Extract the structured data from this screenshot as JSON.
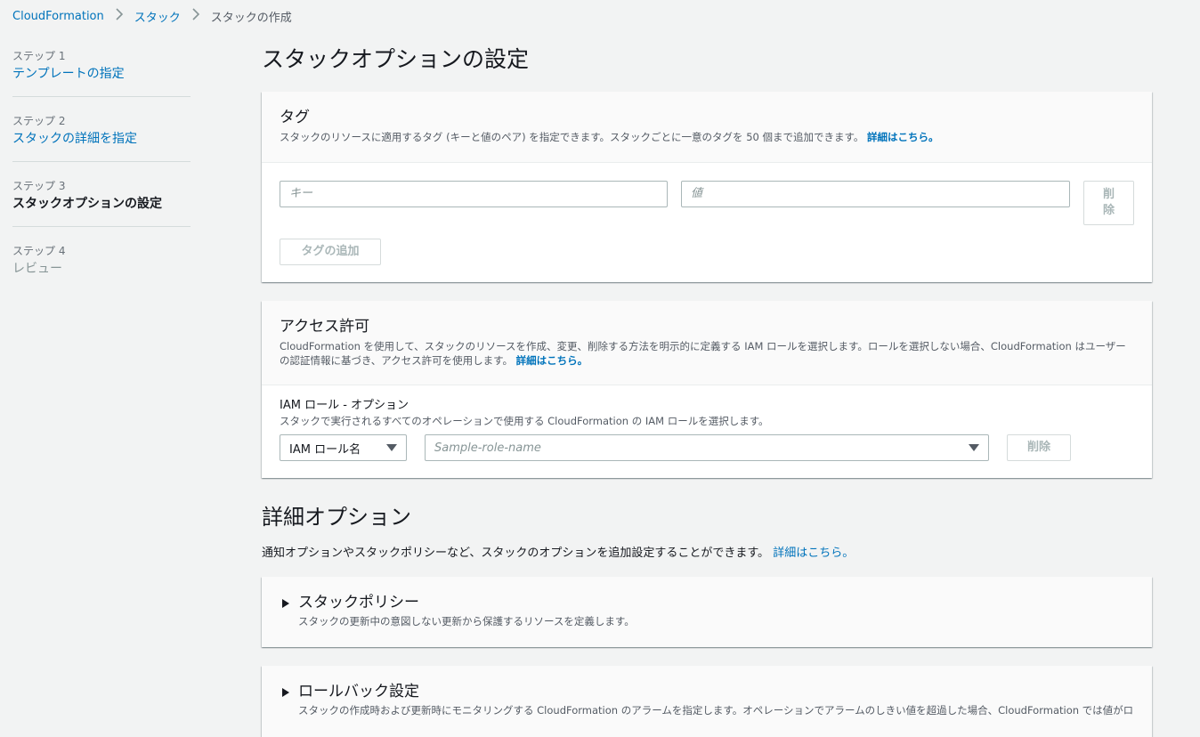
{
  "breadcrumb": {
    "items": [
      "CloudFormation",
      "スタック"
    ],
    "current": "スタックの作成"
  },
  "steps": [
    {
      "num": "ステップ 1",
      "title": "テンプレートの指定",
      "state": "link"
    },
    {
      "num": "ステップ 2",
      "title": "スタックの詳細を指定",
      "state": "link"
    },
    {
      "num": "ステップ 3",
      "title": "スタックオプションの設定",
      "state": "active"
    },
    {
      "num": "ステップ 4",
      "title": "レビュー",
      "state": "disabled"
    }
  ],
  "page_title": "スタックオプションの設定",
  "tags": {
    "title": "タグ",
    "desc": "スタックのリソースに適用するタグ (キーと値のペア) を指定できます。スタックごとに一意のタグを 50 個まで追加できます。",
    "learn_more": "詳細はこちら。",
    "key_placeholder": "キー",
    "value_placeholder": "値",
    "remove_label": "削除",
    "add_label": "タグの追加"
  },
  "permissions": {
    "title": "アクセス許可",
    "desc": "CloudFormation を使用して、スタックのリソースを作成、変更、削除する方法を明示的に定義する IAM ロールを選択します。ロールを選択しない場合、CloudFormation はユーザーの認証情報に基づき、アクセス許可を使用します。",
    "learn_more": "詳細はこちら。",
    "role_label": "IAM ロール - オプション",
    "role_desc": "スタックで実行されるすべてのオペレーションで使用する CloudFormation の IAM ロールを選択します。",
    "role_type": "IAM ロール名",
    "role_placeholder": "Sample-role-name",
    "remove_label": "削除"
  },
  "advanced": {
    "title": "詳細オプション",
    "desc": "通知オプションやスタックポリシーなど、スタックのオプションを追加設定することができます。",
    "learn_more": "詳細はこちら。"
  },
  "stack_policy": {
    "title": "スタックポリシー",
    "desc": "スタックの更新中の意図しない更新から保護するリソースを定義します。"
  },
  "rollback": {
    "title": "ロールバック設定",
    "desc": "スタックの作成時および更新時にモニタリングする CloudFormation のアラームを指定します。オペレーションでアラームのしきい値を超過した場合、CloudFormation では値がロールバッ"
  }
}
